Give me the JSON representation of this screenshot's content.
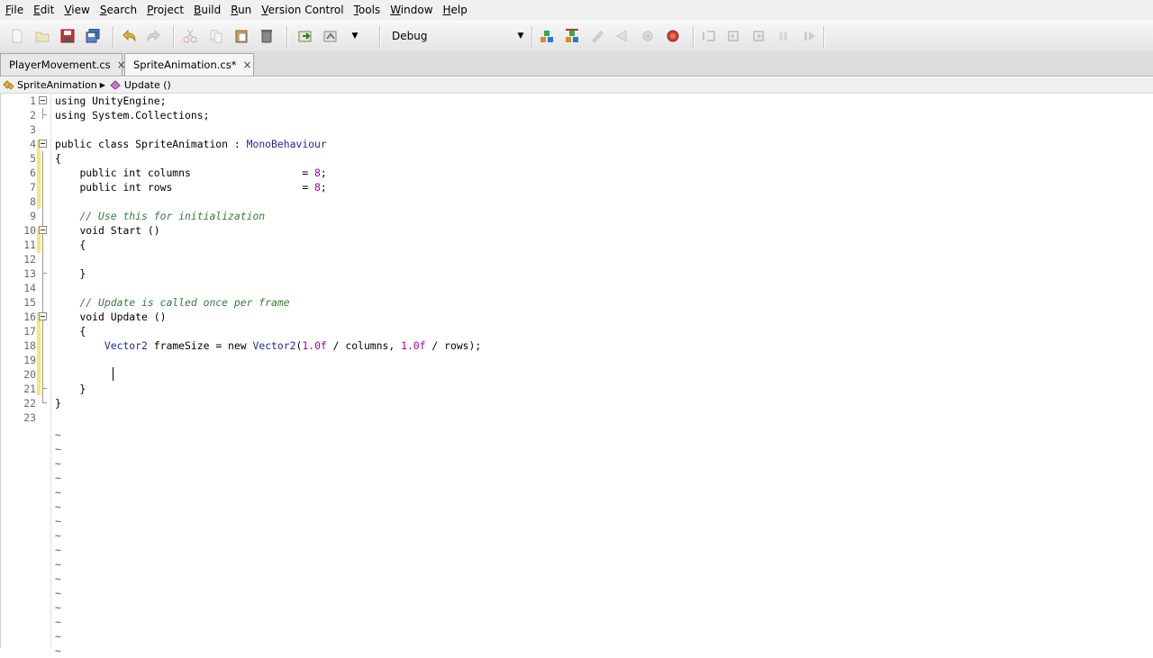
{
  "menu": [
    "File",
    "Edit",
    "View",
    "Search",
    "Project",
    "Build",
    "Run",
    "Version Control",
    "Tools",
    "Window",
    "Help"
  ],
  "toolbar": {
    "configuration": "Debug",
    "icons": [
      "new-file-icon",
      "open-file-icon",
      "save-icon",
      "save-all-icon",
      "undo-icon",
      "redo-icon",
      "cut-icon",
      "copy-icon",
      "paste-icon",
      "delete-icon",
      "build-icon",
      "rebuild-icon",
      "dropdown-icon",
      "configuration-dropdown-icon",
      "build-solution-icon",
      "rebuild-solution-icon",
      "clean-icon",
      "run-icon",
      "debug-icon",
      "stop-icon",
      "step-over-icon",
      "step-into-icon",
      "step-out-icon",
      "pause-icon",
      "continue-icon"
    ]
  },
  "tabs": [
    {
      "label": "PlayerMovement.cs",
      "close": "×"
    },
    {
      "label": "SpriteAnimation.cs*",
      "close": "×"
    }
  ],
  "breadcrumb": {
    "class": "SpriteAnimation",
    "method": "Update ()"
  },
  "editor": {
    "lines": [
      {
        "n": "1",
        "tokens": [
          [
            "kw",
            "using "
          ],
          [
            "plain",
            "UnityEngine;"
          ]
        ]
      },
      {
        "n": "2",
        "tokens": [
          [
            "kw",
            "using "
          ],
          [
            "plain",
            "System.Collections;"
          ]
        ]
      },
      {
        "n": "3",
        "tokens": []
      },
      {
        "n": "4",
        "tokens": [
          [
            "kw",
            "public class "
          ],
          [
            "plain",
            "SpriteAnimation : "
          ],
          [
            "type",
            "MonoBehaviour"
          ]
        ]
      },
      {
        "n": "5",
        "tokens": [
          [
            "plain",
            "{"
          ]
        ]
      },
      {
        "n": "6",
        "tokens": [
          [
            "plain",
            "    "
          ],
          [
            "kw",
            "public int "
          ],
          [
            "plain",
            "columns                  = "
          ],
          [
            "num",
            "8"
          ],
          [
            "plain",
            ";"
          ]
        ]
      },
      {
        "n": "7",
        "tokens": [
          [
            "plain",
            "    "
          ],
          [
            "kw",
            "public int "
          ],
          [
            "plain",
            "rows                     = "
          ],
          [
            "num",
            "8"
          ],
          [
            "plain",
            ";"
          ]
        ]
      },
      {
        "n": "8",
        "tokens": []
      },
      {
        "n": "9",
        "tokens": [
          [
            "plain",
            "    "
          ],
          [
            "cmt",
            "// Use this for initialization"
          ]
        ]
      },
      {
        "n": "10",
        "tokens": [
          [
            "plain",
            "    "
          ],
          [
            "kw",
            "void "
          ],
          [
            "plain",
            "Start ()"
          ]
        ]
      },
      {
        "n": "11",
        "tokens": [
          [
            "plain",
            "    {"
          ]
        ]
      },
      {
        "n": "12",
        "tokens": []
      },
      {
        "n": "13",
        "tokens": [
          [
            "plain",
            "    }"
          ]
        ]
      },
      {
        "n": "14",
        "tokens": []
      },
      {
        "n": "15",
        "tokens": [
          [
            "plain",
            "    "
          ],
          [
            "cmt",
            "// Update is called once per frame"
          ]
        ]
      },
      {
        "n": "16",
        "tokens": [
          [
            "plain",
            "    "
          ],
          [
            "kw",
            "void "
          ],
          [
            "plain",
            "Update ()"
          ]
        ]
      },
      {
        "n": "17",
        "tokens": [
          [
            "plain",
            "    {"
          ]
        ]
      },
      {
        "n": "18",
        "tokens": [
          [
            "plain",
            "        "
          ],
          [
            "type",
            "Vector2"
          ],
          [
            "plain",
            " frameSize = "
          ],
          [
            "kw",
            "new "
          ],
          [
            "type",
            "Vector2"
          ],
          [
            "plain",
            "("
          ],
          [
            "num",
            "1.0f"
          ],
          [
            "plain",
            " / columns, "
          ],
          [
            "num",
            "1.0f"
          ],
          [
            "plain",
            " / rows);"
          ]
        ]
      },
      {
        "n": "19",
        "tokens": []
      },
      {
        "n": "20",
        "tokens": [
          [
            "plain",
            "        "
          ]
        ]
      },
      {
        "n": "21",
        "tokens": [
          [
            "plain",
            "    }"
          ]
        ]
      },
      {
        "n": "22",
        "tokens": [
          [
            "plain",
            "}"
          ]
        ]
      },
      {
        "n": "23",
        "tokens": []
      }
    ],
    "tilde": "~",
    "tilde_count": 16
  }
}
